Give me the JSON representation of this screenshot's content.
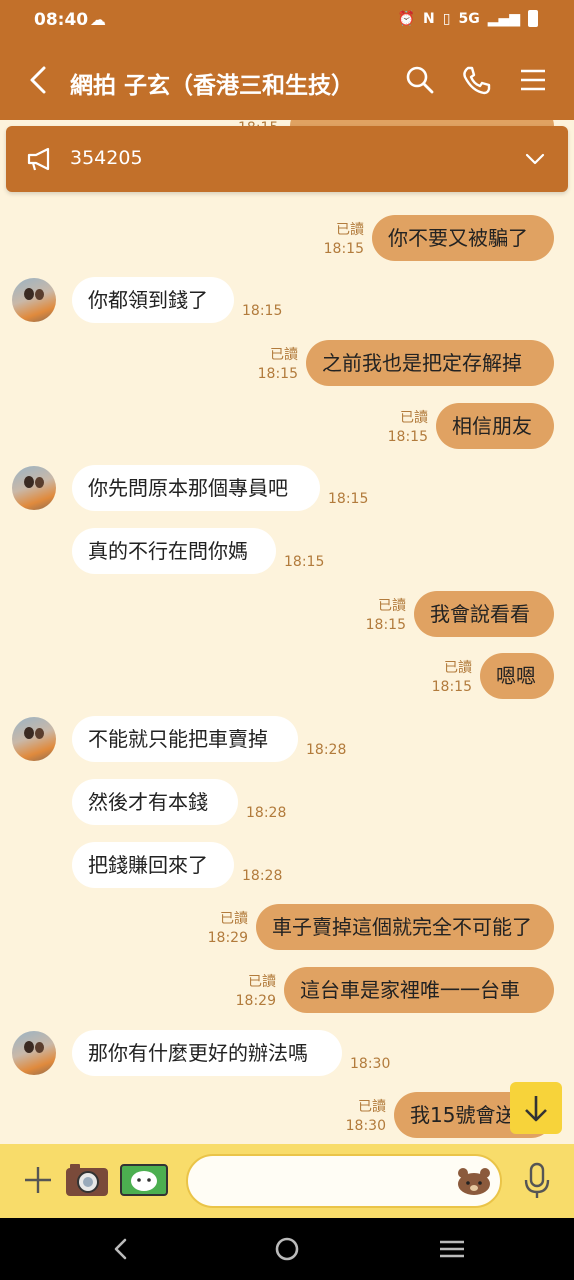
{
  "status": {
    "time": "08:40",
    "network": "5G"
  },
  "header": {
    "title": "網拍 子玄（香港三和生技）"
  },
  "notice": {
    "text": "354205"
  },
  "partial_top": {
    "time": "18:15"
  },
  "messages": [
    {
      "dir": "out",
      "read": "已讀",
      "time": "18:15",
      "text": "你不要又被騙了"
    },
    {
      "dir": "in",
      "avatar": true,
      "time": "18:15",
      "text": "你都領到錢了"
    },
    {
      "dir": "out",
      "read": "已讀",
      "time": "18:15",
      "text": "之前我也是把定存解掉"
    },
    {
      "dir": "out",
      "read": "已讀",
      "time": "18:15",
      "text": "相信朋友"
    },
    {
      "dir": "in",
      "avatar": true,
      "time": "18:15",
      "text": "你先問原本那個專員吧"
    },
    {
      "dir": "in",
      "avatar": false,
      "time": "18:15",
      "text": "真的不行在問你媽"
    },
    {
      "dir": "out",
      "read": "已讀",
      "time": "18:15",
      "text": "我會說看看"
    },
    {
      "dir": "out",
      "read": "已讀",
      "time": "18:15",
      "text": "嗯嗯"
    },
    {
      "dir": "in",
      "avatar": true,
      "time": "18:28",
      "text": "不能就只能把車賣掉"
    },
    {
      "dir": "in",
      "avatar": false,
      "time": "18:28",
      "text": "然後才有本錢"
    },
    {
      "dir": "in",
      "avatar": false,
      "time": "18:28",
      "text": "把錢賺回來了"
    },
    {
      "dir": "out",
      "read": "已讀",
      "time": "18:29",
      "text": "車子賣掉這個就完全不可能了"
    },
    {
      "dir": "out",
      "read": "已讀",
      "time": "18:29",
      "text": "這台車是家裡唯一一台車"
    },
    {
      "dir": "in",
      "avatar": true,
      "time": "18:30",
      "text": "那你有什麼更好的辦法嗎"
    },
    {
      "dir": "out",
      "read": "已讀",
      "time": "18:30",
      "text": "我15號會送"
    }
  ],
  "input": {
    "value": ""
  },
  "colors": {
    "header": "#c2702a",
    "background": "#fdf3dc",
    "outgoing": "#e0a262",
    "incoming": "#ffffff",
    "input_bar": "#f8dc6a"
  },
  "icons": [
    "back-arrow-icon",
    "search-icon",
    "phone-icon",
    "menu-icon",
    "megaphone-icon",
    "chevron-down-icon",
    "plus-icon",
    "camera-icon",
    "photo-icon",
    "emoji-bear-icon",
    "mic-icon",
    "scroll-down-icon"
  ]
}
